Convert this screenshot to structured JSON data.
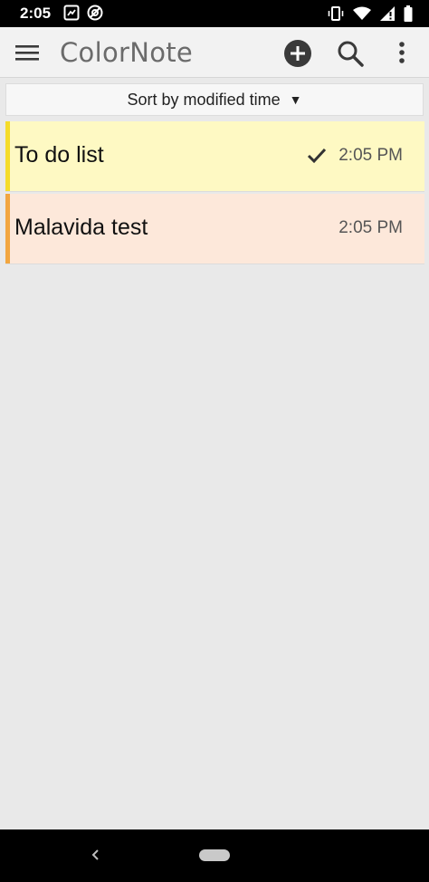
{
  "status_bar": {
    "time": "2:05",
    "icons": [
      "screenshot-icon",
      "do-not-disturb-icon",
      "vibrate-icon",
      "wifi-icon",
      "alert-icon",
      "battery-icon"
    ]
  },
  "toolbar": {
    "title": "ColorNote",
    "icons": [
      "menu-icon",
      "add-icon",
      "search-icon",
      "more-vert-icon"
    ]
  },
  "sort": {
    "label": "Sort by modified time",
    "arrow": "▼"
  },
  "notes": [
    {
      "title": "To do list",
      "time": "2:05 PM",
      "checked": true,
      "color": "#fef9c3",
      "accent": "#f5dc2a"
    },
    {
      "title": "Malavida test",
      "time": "2:05 PM",
      "checked": false,
      "color": "#fde8da",
      "accent": "#f2a640"
    }
  ],
  "colors": {
    "toolbar_bg": "#f2f2f2",
    "list_bg": "#e9e9e9",
    "icon": "#3a3a3a"
  }
}
